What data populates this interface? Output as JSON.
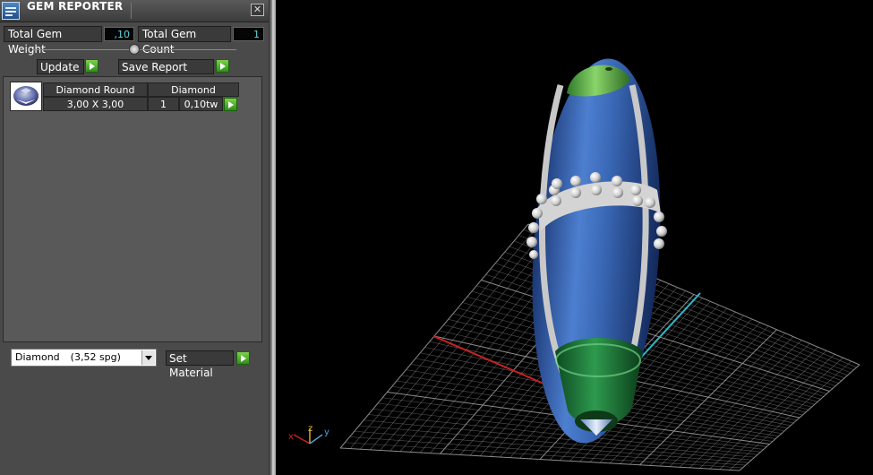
{
  "panel": {
    "title": "GEM REPORTER",
    "close_glyph": "✕",
    "total_weight_label": "Total Gem Weight",
    "total_weight_value": ",10",
    "total_count_label": "Total Gem Count",
    "total_count_value": "1",
    "update_label": "Update",
    "save_report_label": "Save Report",
    "gem_rows": [
      {
        "name": "Diamond Round",
        "material": "Diamond",
        "size": "3,00 X 3,00",
        "count": "1",
        "weight": "0,10tw"
      }
    ],
    "material_select": {
      "name": "Diamond",
      "spg": "(3,52 spg)"
    },
    "set_material_label": "Set Material"
  },
  "viewport": {
    "axes": {
      "x_label": "x",
      "y_label": "y",
      "z_label": "z"
    },
    "colors": {
      "x_axis": "#cc2222",
      "y_axis": "#2fb7c9",
      "grid": "#9a9a9a",
      "gem_blue": "#3a6ab8",
      "gem_green": "#2b8c45",
      "rail_gray": "#c8c8c8"
    }
  }
}
